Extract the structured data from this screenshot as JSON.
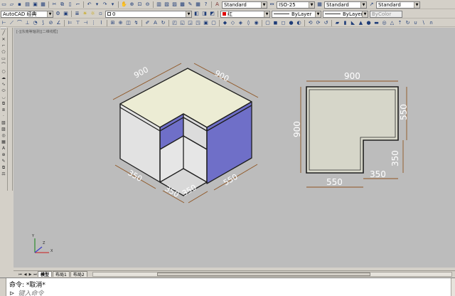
{
  "toolbar": {
    "workspace": "AutoCAD 经典",
    "layer_value": "0",
    "text_style": "Standard",
    "dim_style": "ISO-25",
    "table_style": "Standard",
    "multileader_style": "Standard",
    "color": "红",
    "linetype": "ByLayer",
    "lineweight": "ByLayer",
    "plotstyle": "ByColor"
  },
  "viewport_label": "[-][东南等轴测][二维线框]",
  "drawing": {
    "iso_dims": [
      "900",
      "900",
      "350",
      "350",
      "350",
      "550"
    ],
    "plan_dims": {
      "top": "900",
      "left": "900",
      "right": "550",
      "right_low": "350",
      "bottom": "550",
      "bottom_right": "350"
    },
    "ucs": {
      "x": "X",
      "y": "Y",
      "z": "Z"
    }
  },
  "tabs": [
    "模型",
    "布局1",
    "布局2"
  ],
  "command": {
    "history": "命令: *取消*",
    "prompt_icon": "⊳",
    "placeholder": "键入命令"
  },
  "colors": {
    "canvas": "#bcbcbc",
    "top_face": "#ececd4",
    "blue_face": "#6f6fc8",
    "light_face": "#e2e2e2",
    "dim_line": "#8f5522"
  }
}
